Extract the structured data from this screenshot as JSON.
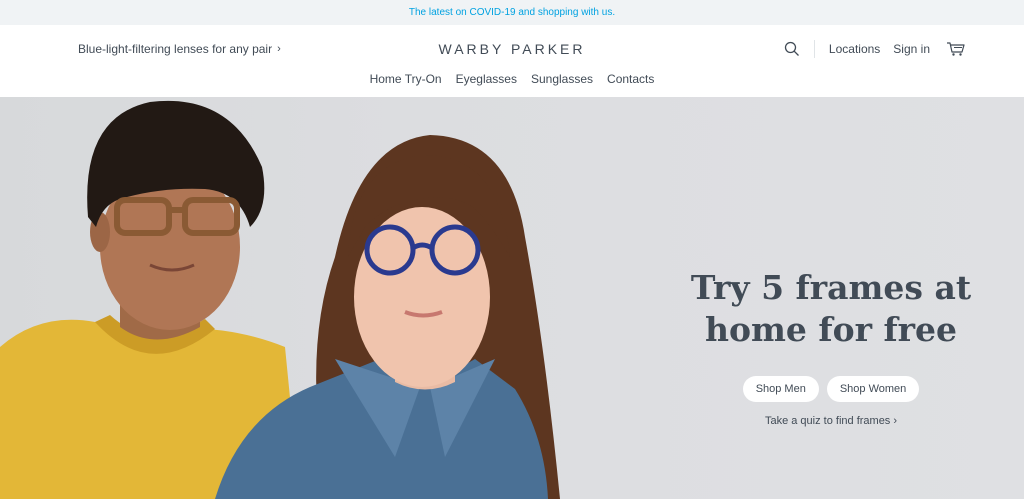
{
  "banner": {
    "text": "The latest on COVID-19 and shopping with us."
  },
  "header": {
    "promo": "Blue-light-filtering lenses for any pair",
    "promo_chevron": "›",
    "logo": "WARBY PARKER",
    "locations": "Locations",
    "sign_in": "Sign in"
  },
  "nav": {
    "items": [
      "Home Try-On",
      "Eyeglasses",
      "Sunglasses",
      "Contacts"
    ]
  },
  "hero": {
    "headline_line1": "Try 5 frames at",
    "headline_line2": "home for free",
    "shop_men": "Shop Men",
    "shop_women": "Shop Women",
    "quiz": "Take a quiz to find frames ›"
  },
  "icons": [
    "search-icon",
    "cart-icon"
  ],
  "colors": {
    "banner_link": "#00a2e1",
    "text": "#414b56",
    "banner_bg": "#f0f3f5"
  }
}
